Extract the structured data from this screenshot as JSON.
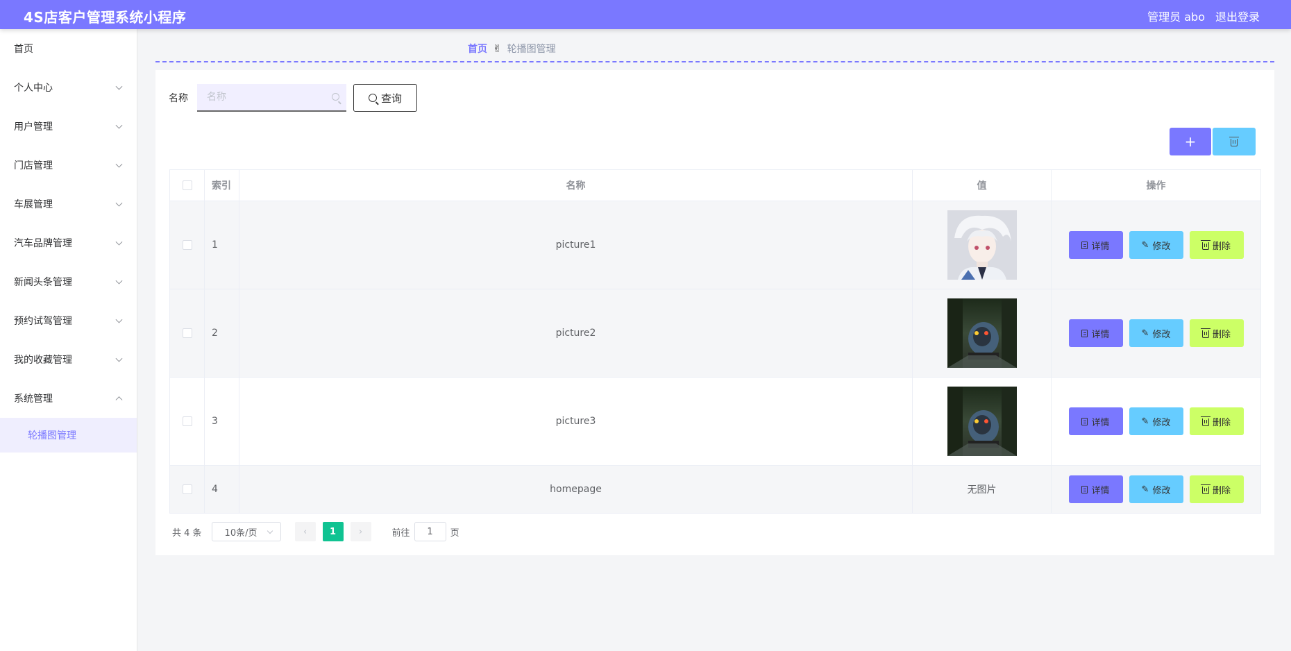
{
  "header": {
    "title": "4S店客户管理系统小程序",
    "admin_label": "管理员 abo",
    "logout_label": "退出登录"
  },
  "sidebar": {
    "items": [
      {
        "label": "首页"
      },
      {
        "label": "个人中心"
      },
      {
        "label": "用户管理"
      },
      {
        "label": "门店管理"
      },
      {
        "label": "车展管理"
      },
      {
        "label": "汽车品牌管理"
      },
      {
        "label": "新闻头条管理"
      },
      {
        "label": "预约试驾管理"
      },
      {
        "label": "我的收藏管理"
      },
      {
        "label": "系统管理"
      }
    ],
    "active_sub": "轮播图管理"
  },
  "breadcrumb": {
    "home": "首页",
    "current": "轮播图管理"
  },
  "search": {
    "label": "名称",
    "placeholder": "名称",
    "button": "查询"
  },
  "actions": {
    "add": "+"
  },
  "table": {
    "headers": [
      "索引",
      "名称",
      "值",
      "操作"
    ],
    "rows": [
      {
        "index": "1",
        "name": "picture1",
        "value": ""
      },
      {
        "index": "2",
        "name": "picture2",
        "value": ""
      },
      {
        "index": "3",
        "name": "picture3",
        "value": ""
      },
      {
        "index": "4",
        "name": "homepage",
        "value": "无图片"
      }
    ],
    "op_detail": "详情",
    "op_edit": "修改",
    "op_delete": "删除"
  },
  "pagination": {
    "total": "共 4 条",
    "page_size": "10条/页",
    "current_page": "1",
    "goto_prefix": "前往",
    "goto_value": "1",
    "goto_suffix": "页"
  },
  "colors": {
    "accent": "#7a78ff",
    "edit": "#66ccff",
    "delete": "#ccff66",
    "page_active": "#10c392"
  }
}
